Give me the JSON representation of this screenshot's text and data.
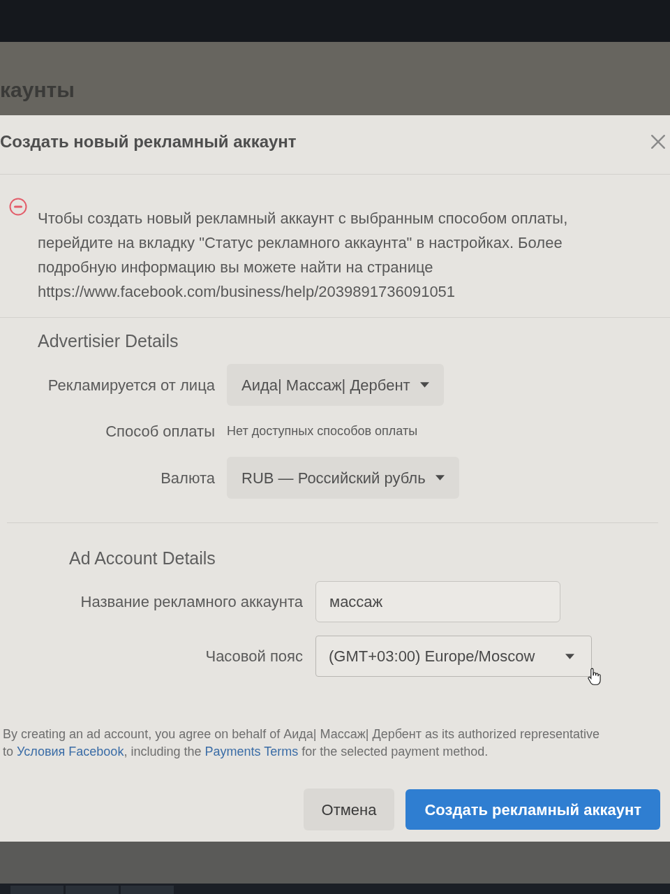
{
  "background_page": {
    "heading": "каунты"
  },
  "dialog": {
    "title": "Создать новый рекламный аккаунт"
  },
  "error": {
    "message": "Чтобы создать новый рекламный аккаунт с выбранным способом оплаты, перейдите на вкладку \"Статус рекламного аккаунта\" в настройках. Более подробную информацию вы можете найти на странице https://www.facebook.com/business/help/2039891736091051"
  },
  "advertiser_details": {
    "title": "Advertisier Details",
    "rows": [
      {
        "kind": "select",
        "label": "Рекламируется от лица",
        "value": "Аида| Массаж| Дербент"
      },
      {
        "kind": "info",
        "label": "Способ оплаты",
        "value": "Нет доступных способов оплаты"
      },
      {
        "kind": "select",
        "label": "Валюта",
        "value": "RUB — Российский рубль"
      }
    ]
  },
  "ad_account_details": {
    "title": "Ad Account Details",
    "rows": [
      {
        "kind": "input",
        "label": "Название рекламного аккаунта",
        "value": "массаж"
      },
      {
        "kind": "outlined_select",
        "label": "Часовой пояс",
        "value": "(GMT+03:00) Europe/Moscow"
      }
    ]
  },
  "terms": {
    "parts": [
      {
        "kind": "text",
        "text": "By creating an ad account, you agree on behalf of Аида| Массаж| Дербент as its authorized representative to "
      },
      {
        "kind": "link",
        "text": "Условия Facebook"
      },
      {
        "kind": "text",
        "text": ", including the "
      },
      {
        "kind": "link",
        "text": "Payments Terms"
      },
      {
        "kind": "text",
        "text": " for the selected payment method."
      }
    ]
  },
  "buttons": [
    {
      "kind": "secondary",
      "label": "Отмена"
    },
    {
      "kind": "primary",
      "label": "Создать рекламный аккаунт"
    }
  ]
}
